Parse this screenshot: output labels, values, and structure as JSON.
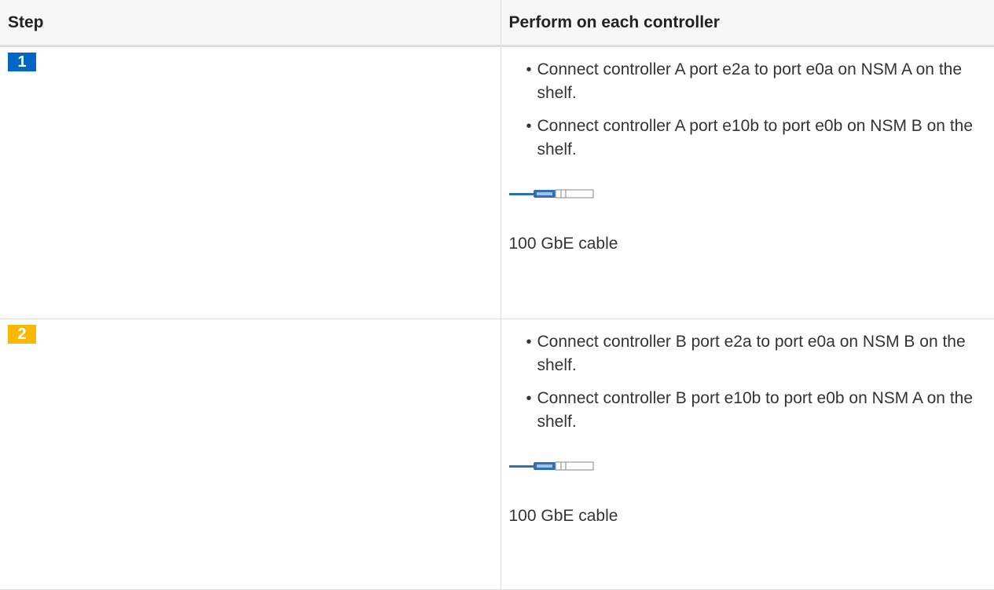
{
  "table": {
    "headers": {
      "step": "Step",
      "perform": "Perform on each controller"
    },
    "rows": [
      {
        "step_number": "1",
        "step_color": "#0067c5",
        "bullets": [
          "Connect controller A port e2a to port e0a on NSM A on the shelf.",
          "Connect controller A port e10b to port e0b on NSM B on the shelf."
        ],
        "cable_icon": "cable-icon",
        "cable_label": "100 GbE cable"
      },
      {
        "step_number": "2",
        "step_color": "#f7b801",
        "bullets": [
          "Connect controller B port e2a to port e0a on NSM B on the shelf.",
          "Connect controller B port e10b to port e0b on NSM A on the shelf."
        ],
        "cable_icon": "cable-icon",
        "cable_label": "100 GbE cable"
      }
    ]
  }
}
